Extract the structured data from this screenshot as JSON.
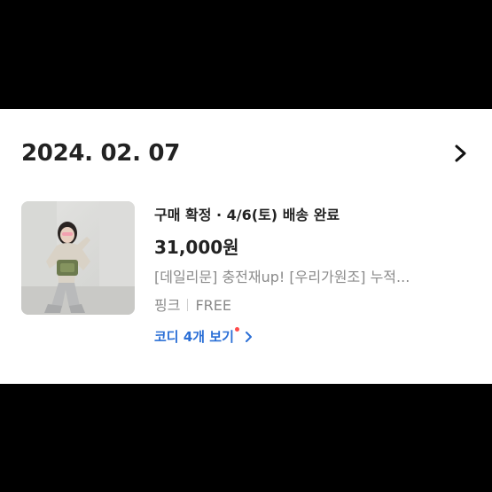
{
  "order": {
    "date": "2024. 02. 07",
    "status": "구매 확정 · 4/6(토) 배송 완료",
    "price": "31,000원",
    "product_name": "[데일리문] 충전재up! [우리가원조] 누적...",
    "option_color": "핑크",
    "option_size": "FREE",
    "codi_link": "코디 4개 보기"
  },
  "icons": {
    "detail": "chevron-right-icon",
    "codi_new": "new-dot-icon",
    "codi_arrow": "chevron-right-icon"
  },
  "colors": {
    "background": "#000000",
    "card": "#ffffff",
    "text_primary": "#222222",
    "text_secondary": "#8a8a8a",
    "link_blue": "#2b6fd6",
    "new_dot": "#ff4a4a"
  }
}
